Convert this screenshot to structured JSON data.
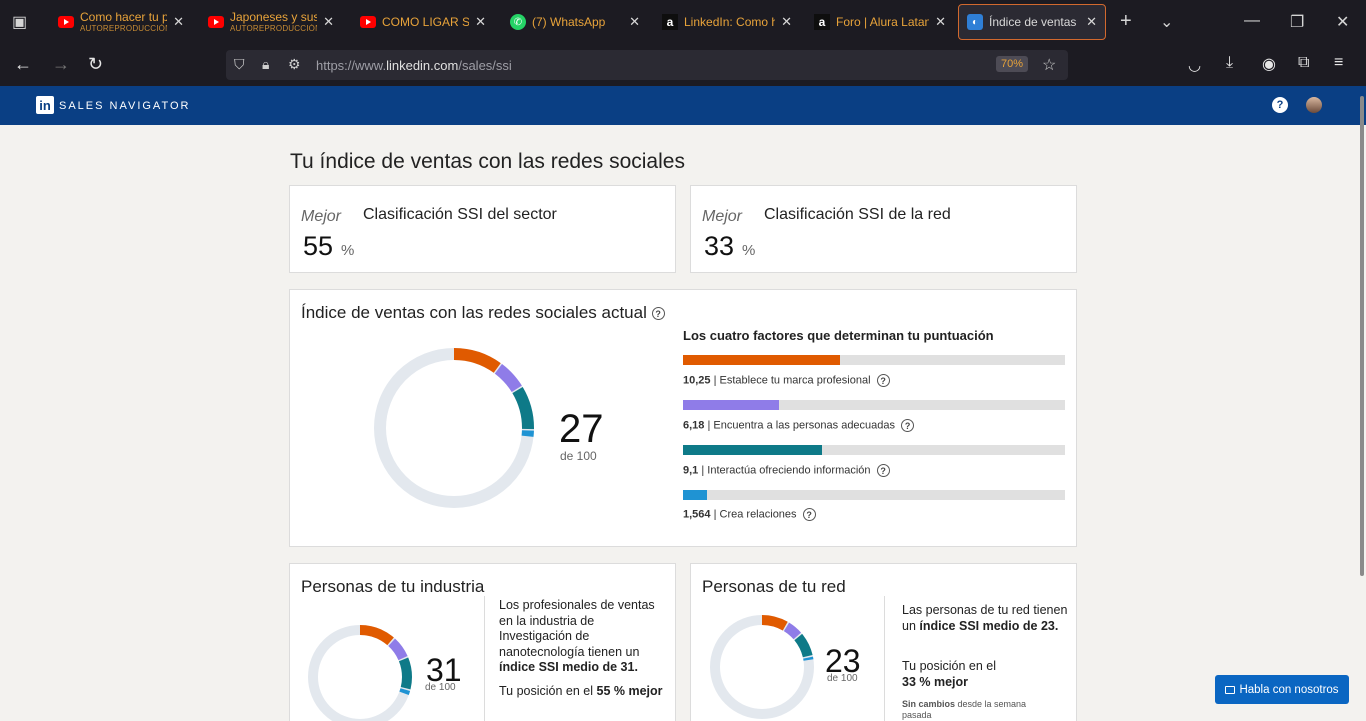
{
  "browser": {
    "tabs": [
      {
        "title": "Como hacer tu pr",
        "subtitle": "AUTOREPRODUCCIÓN",
        "icon": "youtube-icon"
      },
      {
        "title": "Japoneses y sus Fi",
        "subtitle": "AUTOREPRODUCCIÓN",
        "icon": "youtube-icon"
      },
      {
        "title": "COMO LIGAR SIEN",
        "subtitle": "",
        "icon": "youtube-icon"
      },
      {
        "title": "(7) WhatsApp",
        "subtitle": "",
        "icon": "whatsapp-icon"
      },
      {
        "title": "LinkedIn: Como h",
        "subtitle": "",
        "icon": "alura-icon"
      },
      {
        "title": "Foro | Alura Latan",
        "subtitle": "",
        "icon": "alura-icon"
      },
      {
        "title": "Índice de ventas c",
        "subtitle": "",
        "icon": "compass-icon"
      }
    ],
    "url_prefix": "https://www.",
    "url_domain": "linkedin.com",
    "url_path": "/sales/ssi",
    "zoom": "70%"
  },
  "header": {
    "logo": "in",
    "title": "SALES NAVIGATOR"
  },
  "page": {
    "title": "Tu índice de ventas con las redes sociales",
    "rank_cards": [
      {
        "prefix": "Mejor",
        "label": "Clasificación SSI del sector",
        "value": "55",
        "unit": "%"
      },
      {
        "prefix": "Mejor",
        "label": "Clasificación SSI de la red",
        "value": "33",
        "unit": "%"
      }
    ],
    "current": {
      "title": "Índice de ventas con las redes sociales actual",
      "score": "27",
      "of": "de 100",
      "factors_title": "Los cuatro factores que determinan tu puntuación",
      "factors": [
        {
          "value": "10,25",
          "label": "| Establece tu marca profesional",
          "fraction": 0.41,
          "color": "#e05a00"
        },
        {
          "value": "6,18",
          "label": "| Encuentra a las personas adecuadas",
          "fraction": 0.25,
          "color": "#8f7ce8"
        },
        {
          "value": "9,1",
          "label": "| Interactúa ofreciendo información",
          "fraction": 0.365,
          "color": "#0e7a88"
        },
        {
          "value": "1,564",
          "label": "| Crea relaciones",
          "fraction": 0.063,
          "color": "#1f93d3"
        }
      ]
    },
    "industry": {
      "title": "Personas de tu industria",
      "score": "31",
      "of": "de 100",
      "text1": "Los profesionales de ventas en la industria de Investigación de nanotecnología tienen un ",
      "text1_bold": "índice SSI medio de 31.",
      "pos_text": "Tu posición en el ",
      "pos_bold": "55 % mejor"
    },
    "network": {
      "title": "Personas de tu red",
      "score": "23",
      "of": "de 100",
      "text1": "Las personas de tu red tienen un ",
      "text1_bold": "índice SSI medio de 23.",
      "pos_text": "Tu posición en el",
      "pos_bold": "33 % mejor",
      "change_bold": "Sin cambios",
      "change_text": " desde la semana pasada"
    },
    "chat_button": "Habla con nosotros"
  }
}
